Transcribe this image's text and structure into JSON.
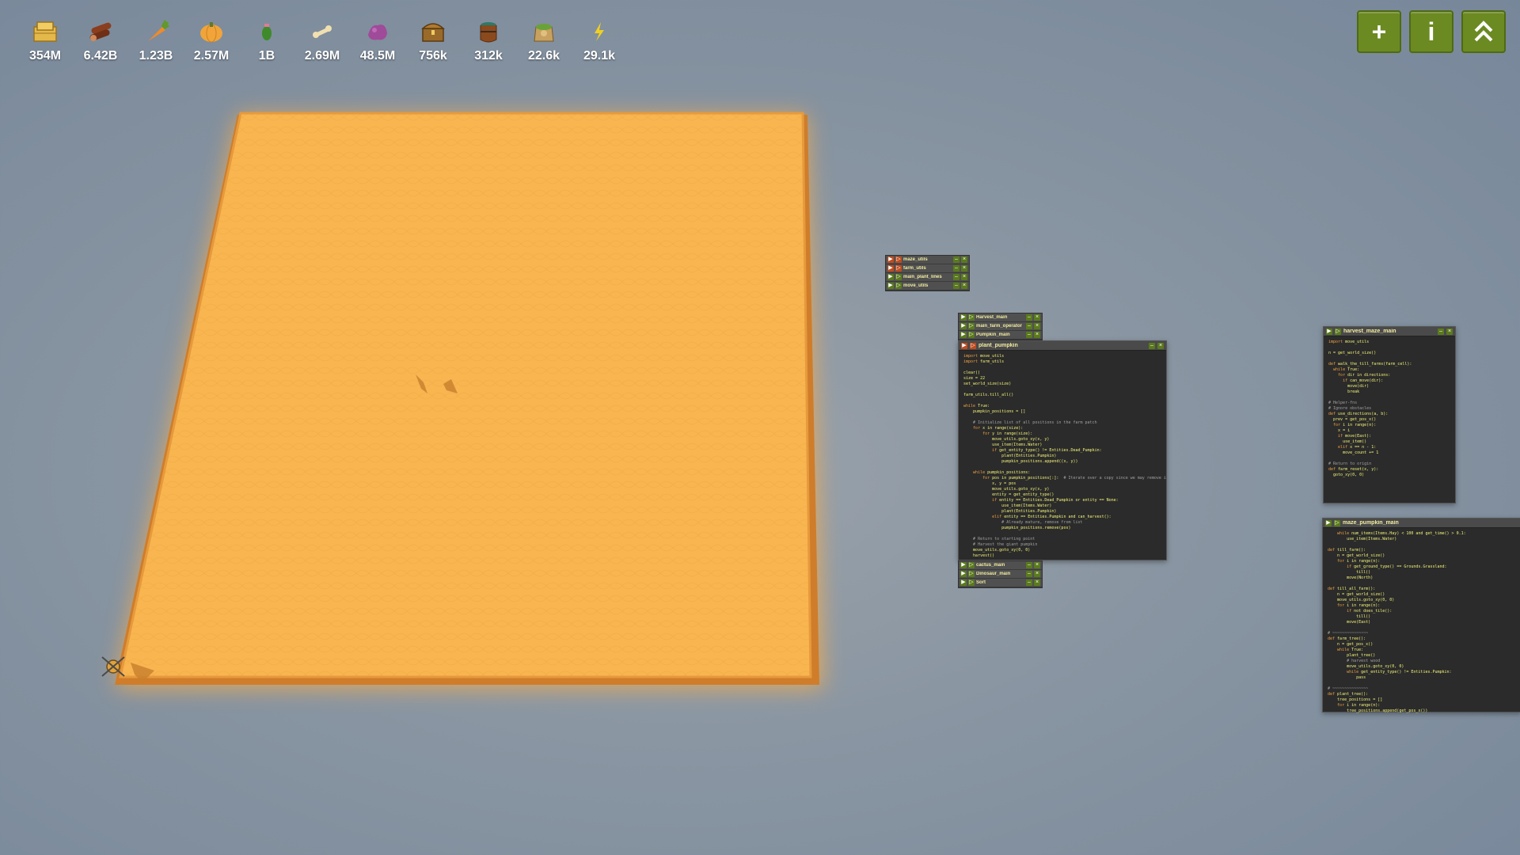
{
  "resources": [
    {
      "icon": "hay-icon",
      "value": "354M"
    },
    {
      "icon": "wood-icon",
      "value": "6.42B"
    },
    {
      "icon": "carrot-icon",
      "value": "1.23B"
    },
    {
      "icon": "pumpkin-icon",
      "value": "2.57M"
    },
    {
      "icon": "cactus-icon",
      "value": "1B"
    },
    {
      "icon": "bone-icon",
      "value": "2.69M"
    },
    {
      "icon": "weird-substance-icon",
      "value": "48.5M"
    },
    {
      "icon": "treasure-chest-icon",
      "value": "756k"
    },
    {
      "icon": "water-barrel-icon",
      "value": "312k"
    },
    {
      "icon": "fertilizer-icon",
      "value": "22.6k"
    },
    {
      "icon": "power-icon",
      "value": "29.1k"
    }
  ],
  "top_buttons": [
    {
      "name": "add-button",
      "label": "+"
    },
    {
      "name": "info-button",
      "label": "i"
    },
    {
      "name": "collapse-button",
      "label": "⌃"
    }
  ],
  "windows": {
    "mini1": [
      "maze_utils",
      "farm_utils",
      "main_plant_lines",
      "move_utils"
    ],
    "mini2_top": [
      "Harvest_main",
      "main_farm_operator",
      "Pumpkin_main"
    ],
    "big_title": "plant_pumpkin",
    "mini2_bottom": [
      "cactus_main",
      "Dinosaur_main",
      "Sort"
    ],
    "right_top_title": "harvest_maze_main",
    "right_bottom_title": "maze_pumpkin_main"
  },
  "colors": {
    "field": "#f8b64f",
    "button": "#6b8a22",
    "window_bg": "#2b2b2b",
    "title_text": "#f2eca0"
  }
}
